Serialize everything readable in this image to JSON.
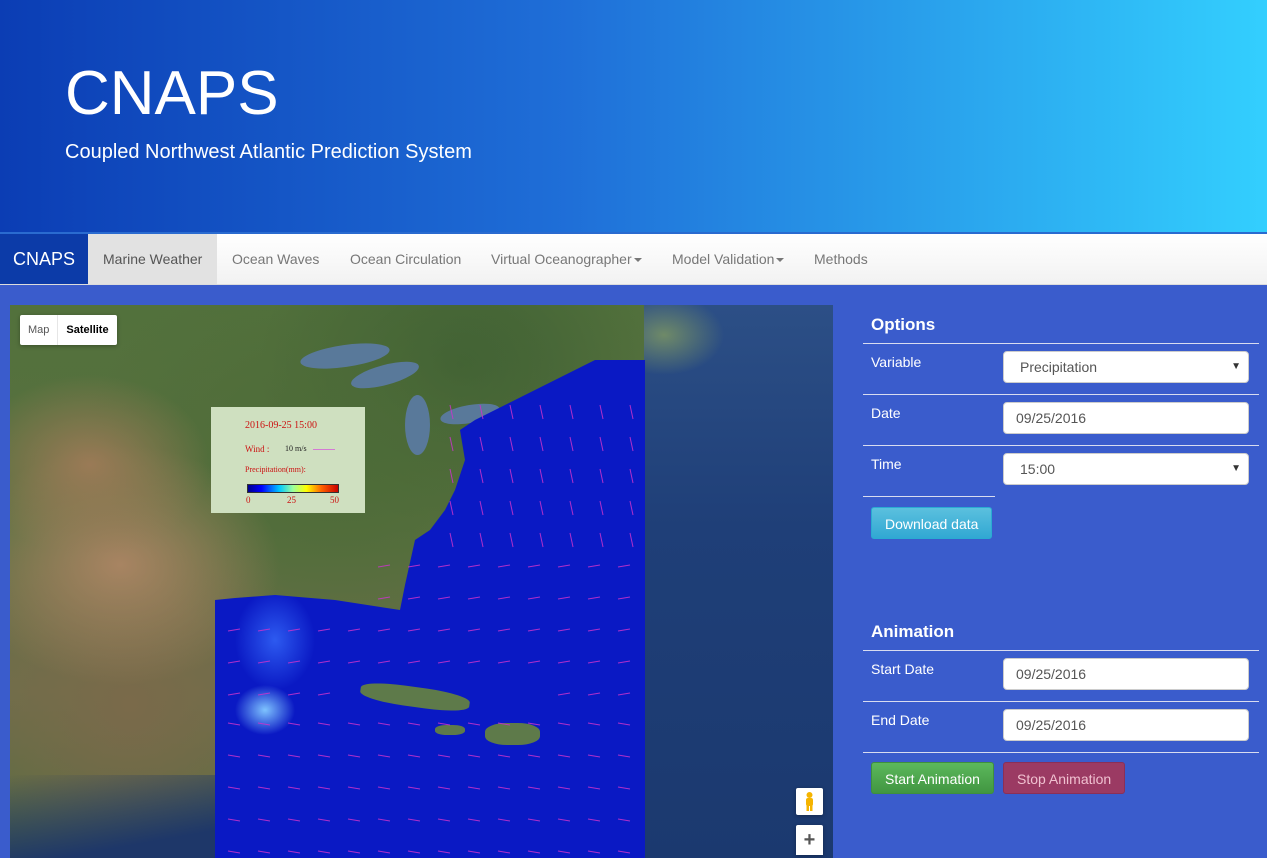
{
  "header": {
    "title": "CNAPS",
    "subtitle": "Coupled Northwest Atlantic Prediction System"
  },
  "nav": {
    "brand": "CNAPS",
    "items": [
      {
        "label": "Marine Weather",
        "active": true
      },
      {
        "label": "Ocean Waves"
      },
      {
        "label": "Ocean Circulation"
      },
      {
        "label": "Virtual Oceanographer",
        "dropdown": true
      },
      {
        "label": "Model Validation",
        "dropdown": true
      },
      {
        "label": "Methods"
      }
    ]
  },
  "map": {
    "type_control": {
      "map": "Map",
      "satellite": "Satellite",
      "selected": "Satellite"
    },
    "legend": {
      "timestamp": "2016-09-25 15:00",
      "wind_label": "Wind :",
      "wind_value": "10  m/s",
      "precip_label": "Precipitation(mm):",
      "ticks": [
        "0",
        "25",
        "50"
      ]
    },
    "zoom_in": "+",
    "arrow_color": "#cc33cc",
    "colors": {
      "ocean_data": "#0a19c4",
      "panel_bg": "#3a5ccc"
    }
  },
  "options": {
    "title": "Options",
    "variable_label": "Variable",
    "variable_value": "Precipitation",
    "date_label": "Date",
    "date_value": "09/25/2016",
    "time_label": "Time",
    "time_value": "15:00",
    "download_button": "Download data"
  },
  "animation": {
    "title": "Animation",
    "start_label": "Start Date",
    "start_value": "09/25/2016",
    "end_label": "End Date",
    "end_value": "09/25/2016",
    "start_button": "Start Animation",
    "stop_button": "Stop Animation"
  }
}
